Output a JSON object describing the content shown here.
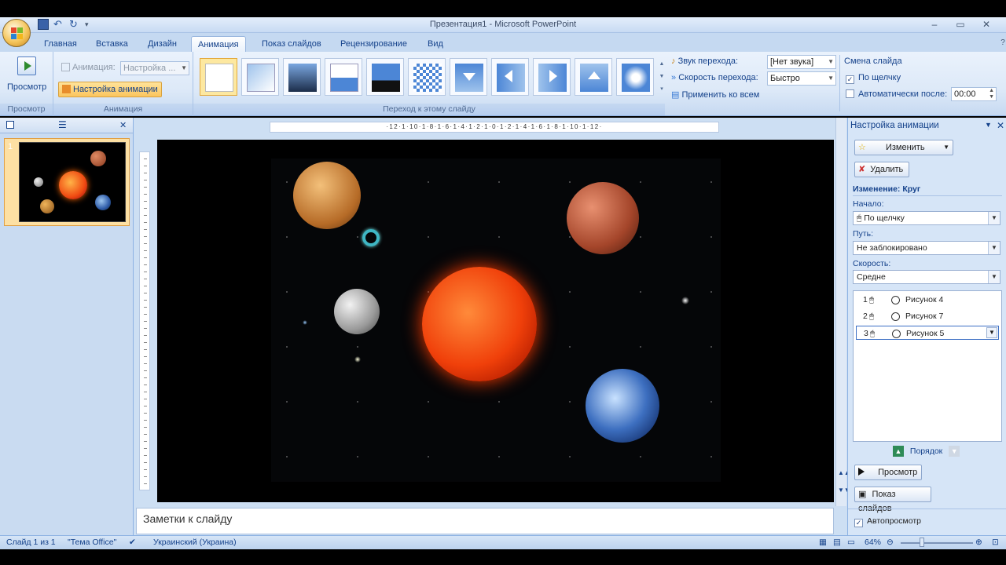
{
  "window": {
    "title": "Презентация1 - Microsoft PowerPoint"
  },
  "tabs": [
    {
      "label": "Главная"
    },
    {
      "label": "Вставка"
    },
    {
      "label": "Дизайн"
    },
    {
      "label": "Анимация"
    },
    {
      "label": "Показ слайдов"
    },
    {
      "label": "Рецензирование"
    },
    {
      "label": "Вид"
    }
  ],
  "ribbon": {
    "preview": {
      "label": "Просмотр",
      "group": "Просмотр"
    },
    "animation": {
      "anim_label": "Анимация:",
      "anim_value": "Настройка ...",
      "custom_btn": "Настройка анимации",
      "group": "Анимация"
    },
    "transition": {
      "sound_label": "Звук перехода:",
      "sound_value": "[Нет звука]",
      "speed_label": "Скорость перехода:",
      "speed_value": "Быстро",
      "apply_all": "Применить ко всем",
      "group": "Переход к этому слайду"
    },
    "advance": {
      "title": "Смена слайда",
      "on_click": "По щелчку",
      "auto_after": "Автоматически после:",
      "auto_time": "00:00"
    }
  },
  "left_pane": {
    "slide_number": "1"
  },
  "editor": {
    "hruler": "·12·1·10·1·8·1·6·1·4·1·2·1·0·1·2·1·4·1·6·1·8·1·10·1·12·",
    "notes_placeholder": "Заметки к слайду"
  },
  "task_pane": {
    "title": "Настройка анимации",
    "change_btn": "Изменить",
    "delete_btn": "Удалить",
    "modify_title": "Изменение: Круг",
    "start_label": "Начало:",
    "start_value": "По щелчку",
    "path_label": "Путь:",
    "path_value": "Не заблокировано",
    "speed_label": "Скорость:",
    "speed_value": "Средне",
    "items": [
      {
        "num": "1",
        "name": "Рисунок 4"
      },
      {
        "num": "2",
        "name": "Рисунок 7"
      },
      {
        "num": "3",
        "name": "Рисунок 5"
      }
    ],
    "order_label": "Порядок",
    "play_btn": "Просмотр",
    "slideshow_btn": "Показ слайдов",
    "autopreview": "Автопросмотр"
  },
  "status": {
    "slide": "Слайд 1 из 1",
    "theme": "\"Тема Office\"",
    "language": "Украинский (Украина)",
    "zoom": "64%"
  },
  "colors": {
    "accent": "#15428b",
    "ribbon_bg": "#dde9f8",
    "selection": "#fde8a0"
  }
}
